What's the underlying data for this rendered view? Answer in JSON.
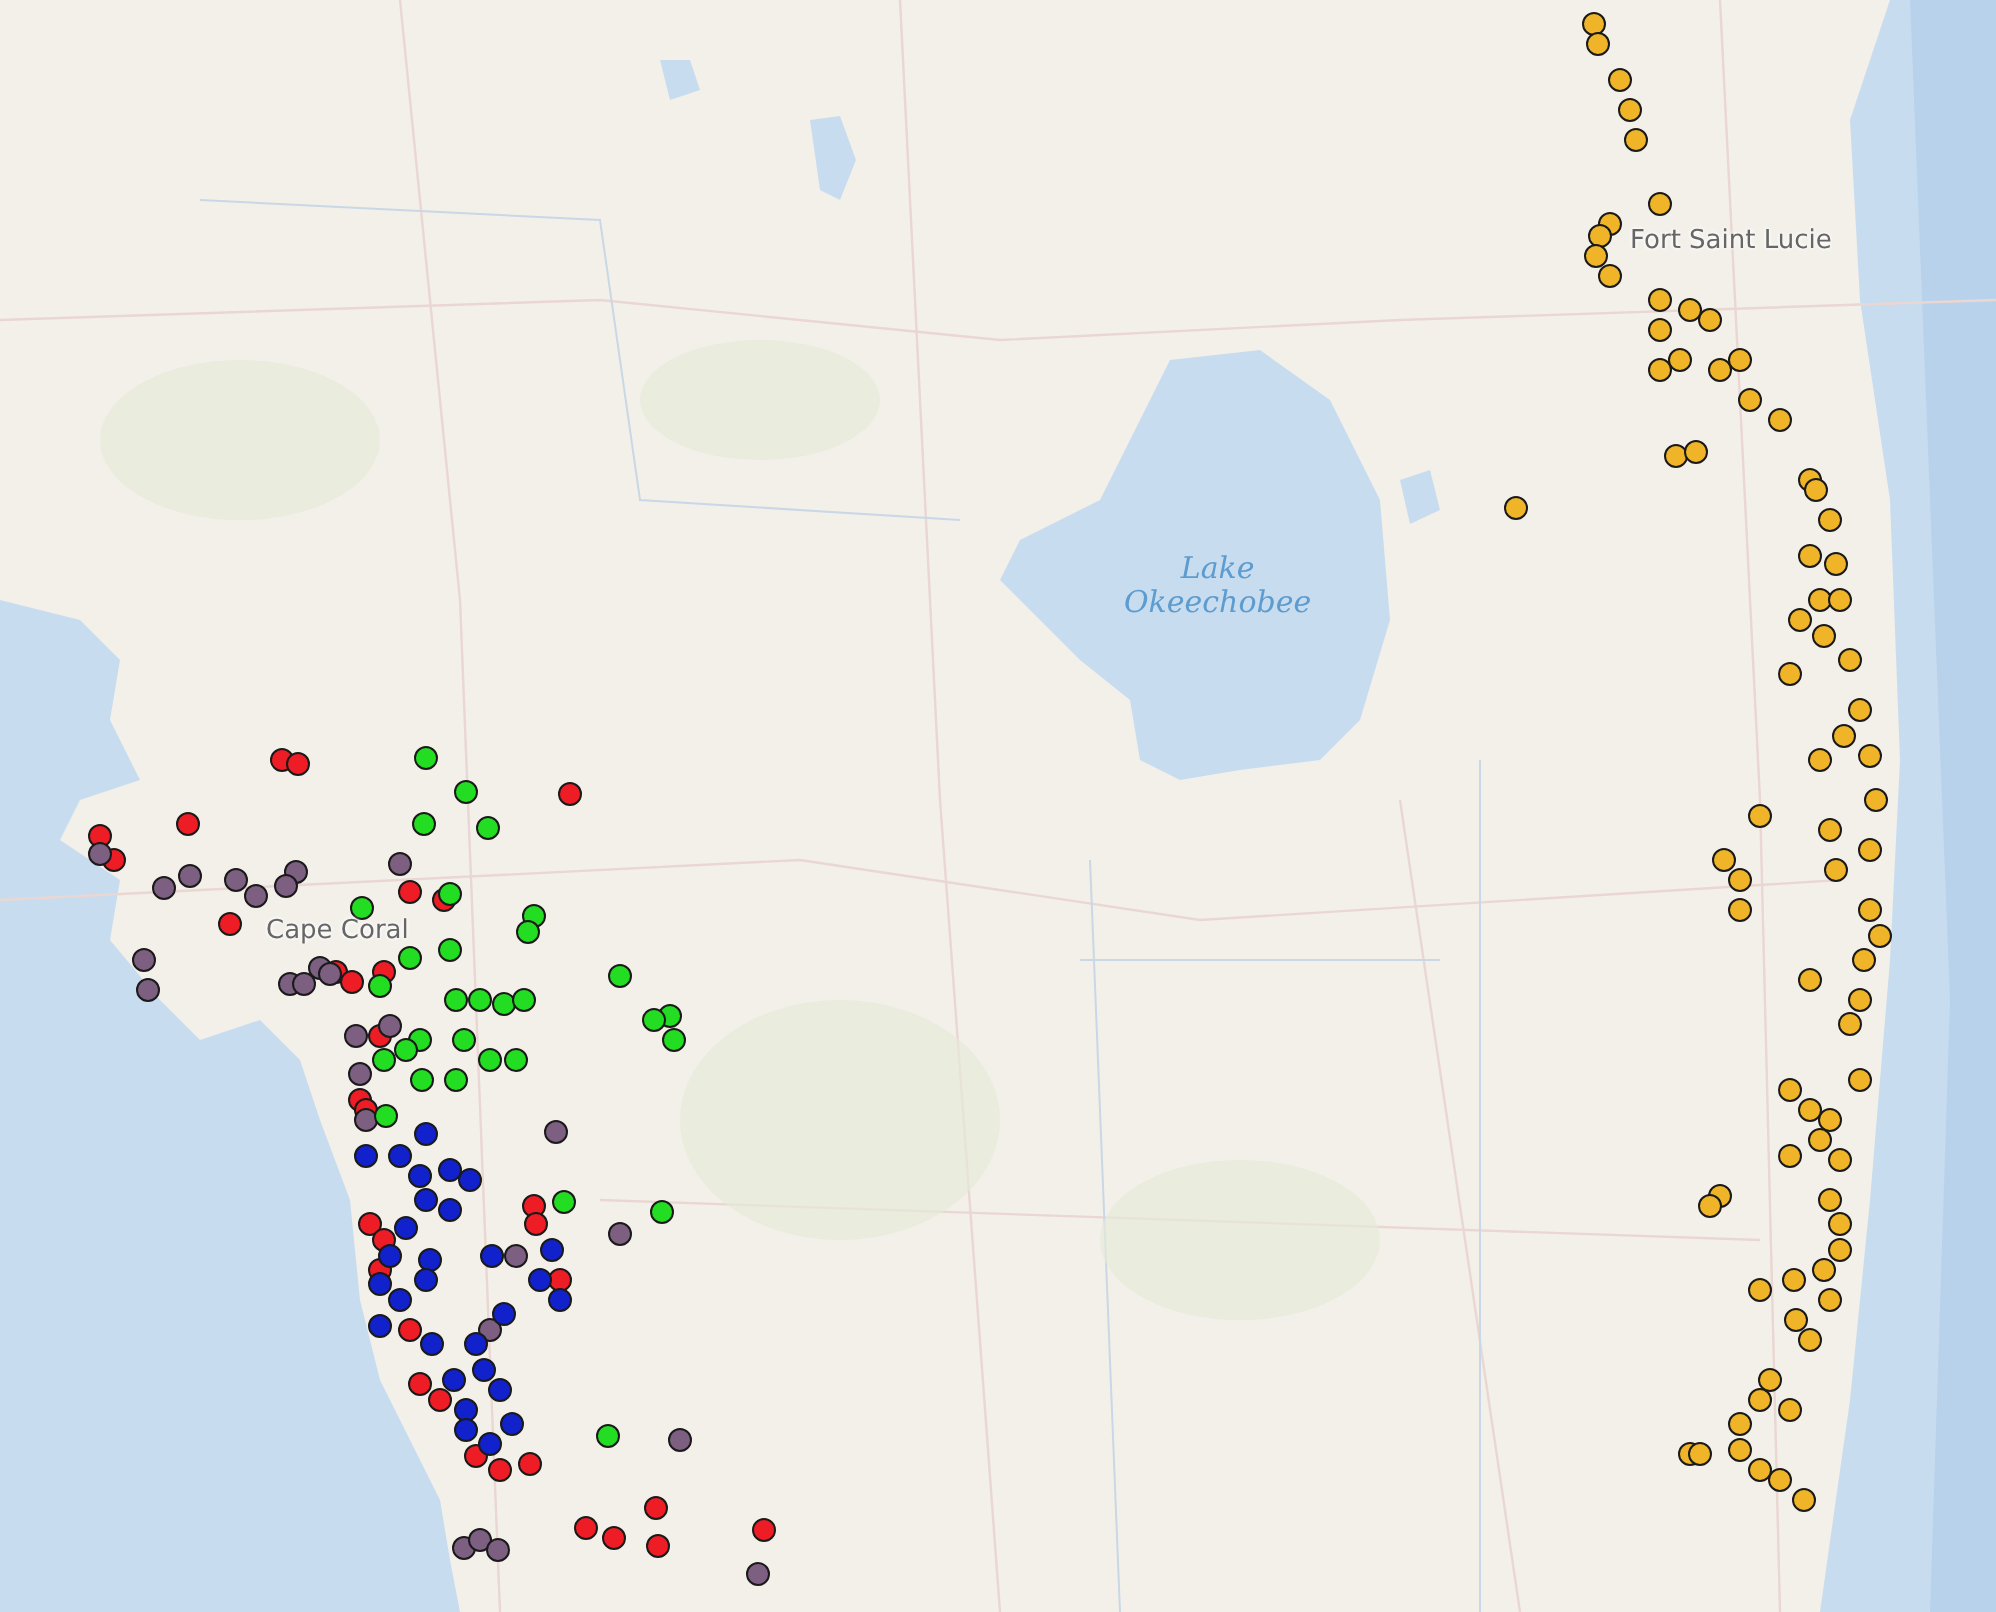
{
  "map": {
    "labels": [
      {
        "kind": "city",
        "text": "Fort Saint Lucie"
      },
      {
        "kind": "water",
        "text": "Lake",
        "text2": "Okeechobee"
      },
      {
        "kind": "city",
        "text": "Cape Coral"
      }
    ],
    "markers": [
      {
        "color": "#f0b429"
      },
      {
        "color": "#f0b429"
      },
      {
        "color": "#f0b429"
      },
      {
        "color": "#f0b429"
      },
      {
        "color": "#f0b429"
      },
      {
        "color": "#f0b429"
      },
      {
        "color": "#f0b429"
      },
      {
        "color": "#f0b429"
      },
      {
        "color": "#f0b429"
      },
      {
        "color": "#f0b429"
      },
      {
        "color": "#f0b429"
      },
      {
        "color": "#f0b429"
      },
      {
        "color": "#f0b429"
      },
      {
        "color": "#f0b429"
      },
      {
        "color": "#f0b429"
      },
      {
        "color": "#f0b429"
      },
      {
        "color": "#f0b429"
      },
      {
        "color": "#f0b429"
      },
      {
        "color": "#f0b429"
      },
      {
        "color": "#f0b429"
      },
      {
        "color": "#f0b429"
      },
      {
        "color": "#f0b429"
      },
      {
        "color": "#f0b429"
      },
      {
        "color": "#f0b429"
      },
      {
        "color": "#f0b429"
      },
      {
        "color": "#f0b429"
      },
      {
        "color": "#f0b429"
      },
      {
        "color": "#f0b429"
      },
      {
        "color": "#f0b429"
      },
      {
        "color": "#f0b429"
      },
      {
        "color": "#f0b429"
      },
      {
        "color": "#f0b429"
      },
      {
        "color": "#f0b429"
      },
      {
        "color": "#f0b429"
      },
      {
        "color": "#f0b429"
      },
      {
        "color": "#f0b429"
      },
      {
        "color": "#f0b429"
      },
      {
        "color": "#f0b429"
      },
      {
        "color": "#f0b429"
      },
      {
        "color": "#f0b429"
      },
      {
        "color": "#f0b429"
      },
      {
        "color": "#f0b429"
      },
      {
        "color": "#f0b429"
      },
      {
        "color": "#f0b429"
      },
      {
        "color": "#f0b429"
      },
      {
        "color": "#f0b429"
      },
      {
        "color": "#f0b429"
      },
      {
        "color": "#f0b429"
      },
      {
        "color": "#f0b429"
      },
      {
        "color": "#f0b429"
      },
      {
        "color": "#f0b429"
      },
      {
        "color": "#f0b429"
      },
      {
        "color": "#f0b429"
      },
      {
        "color": "#f0b429"
      },
      {
        "color": "#f0b429"
      },
      {
        "color": "#f0b429"
      },
      {
        "color": "#f0b429"
      },
      {
        "color": "#f0b429"
      },
      {
        "color": "#f0b429"
      },
      {
        "color": "#f0b429"
      },
      {
        "color": "#f0b429"
      },
      {
        "color": "#f0b429"
      },
      {
        "color": "#f0b429"
      },
      {
        "color": "#f0b429"
      },
      {
        "color": "#f0b429"
      },
      {
        "color": "#f0b429"
      },
      {
        "color": "#f0b429"
      },
      {
        "color": "#f0b429"
      },
      {
        "color": "#f0b429"
      },
      {
        "color": "#f0b429"
      },
      {
        "color": "#f0b429"
      },
      {
        "color": "#f0b429"
      },
      {
        "color": "#f0b429"
      },
      {
        "color": "#f0b429"
      },
      {
        "color": "#f0b429"
      },
      {
        "color": "#f0b429"
      },
      {
        "color": "#f0b429"
      },
      {
        "color": "#f0b429"
      },
      {
        "color": "#f0b429"
      },
      {
        "color": "#f0b429"
      },
      {
        "color": "#ee1c25"
      },
      {
        "color": "#ee1c25"
      },
      {
        "color": "#ee1c25"
      },
      {
        "color": "#ee1c25"
      },
      {
        "color": "#ee1c25"
      },
      {
        "color": "#ee1c25"
      },
      {
        "color": "#ee1c25"
      },
      {
        "color": "#ee1c25"
      },
      {
        "color": "#ee1c25"
      },
      {
        "color": "#ee1c25"
      },
      {
        "color": "#ee1c25"
      },
      {
        "color": "#ee1c25"
      },
      {
        "color": "#ee1c25"
      },
      {
        "color": "#ee1c25"
      },
      {
        "color": "#ee1c25"
      },
      {
        "color": "#ee1c25"
      },
      {
        "color": "#ee1c25"
      },
      {
        "color": "#ee1c25"
      },
      {
        "color": "#ee1c25"
      },
      {
        "color": "#ee1c25"
      },
      {
        "color": "#ee1c25"
      },
      {
        "color": "#ee1c25"
      },
      {
        "color": "#ee1c25"
      },
      {
        "color": "#ee1c25"
      },
      {
        "color": "#ee1c25"
      },
      {
        "color": "#ee1c25"
      },
      {
        "color": "#ee1c25"
      },
      {
        "color": "#ee1c25"
      },
      {
        "color": "#ee1c25"
      },
      {
        "color": "#ee1c25"
      },
      {
        "color": "#ee1c25"
      },
      {
        "color": "#ee1c25"
      },
      {
        "color": "#7d5f82"
      },
      {
        "color": "#7d5f82"
      },
      {
        "color": "#7d5f82"
      },
      {
        "color": "#7d5f82"
      },
      {
        "color": "#7d5f82"
      },
      {
        "color": "#7d5f82"
      },
      {
        "color": "#7d5f82"
      },
      {
        "color": "#7d5f82"
      },
      {
        "color": "#7d5f82"
      },
      {
        "color": "#7d5f82"
      },
      {
        "color": "#7d5f82"
      },
      {
        "color": "#7d5f82"
      },
      {
        "color": "#7d5f82"
      },
      {
        "color": "#7d5f82"
      },
      {
        "color": "#7d5f82"
      },
      {
        "color": "#7d5f82"
      },
      {
        "color": "#7d5f82"
      },
      {
        "color": "#7d5f82"
      },
      {
        "color": "#7d5f82"
      },
      {
        "color": "#7d5f82"
      },
      {
        "color": "#7d5f82"
      },
      {
        "color": "#7d5f82"
      },
      {
        "color": "#7d5f82"
      },
      {
        "color": "#7d5f82"
      },
      {
        "color": "#7d5f82"
      },
      {
        "color": "#7d5f82"
      },
      {
        "color": "#7d5f82"
      },
      {
        "color": "#22dd22"
      },
      {
        "color": "#22dd22"
      },
      {
        "color": "#22dd22"
      },
      {
        "color": "#22dd22"
      },
      {
        "color": "#22dd22"
      },
      {
        "color": "#22dd22"
      },
      {
        "color": "#22dd22"
      },
      {
        "color": "#22dd22"
      },
      {
        "color": "#22dd22"
      },
      {
        "color": "#22dd22"
      },
      {
        "color": "#22dd22"
      },
      {
        "color": "#22dd22"
      },
      {
        "color": "#22dd22"
      },
      {
        "color": "#22dd22"
      },
      {
        "color": "#22dd22"
      },
      {
        "color": "#22dd22"
      },
      {
        "color": "#22dd22"
      },
      {
        "color": "#22dd22"
      },
      {
        "color": "#22dd22"
      },
      {
        "color": "#22dd22"
      },
      {
        "color": "#22dd22"
      },
      {
        "color": "#22dd22"
      },
      {
        "color": "#22dd22"
      },
      {
        "color": "#22dd22"
      },
      {
        "color": "#22dd22"
      },
      {
        "color": "#22dd22"
      },
      {
        "color": "#22dd22"
      },
      {
        "color": "#22dd22"
      },
      {
        "color": "#22dd22"
      },
      {
        "color": "#22dd22"
      },
      {
        "color": "#22dd22"
      },
      {
        "color": "#1122cc"
      },
      {
        "color": "#1122cc"
      },
      {
        "color": "#1122cc"
      },
      {
        "color": "#1122cc"
      },
      {
        "color": "#1122cc"
      },
      {
        "color": "#1122cc"
      },
      {
        "color": "#1122cc"
      },
      {
        "color": "#1122cc"
      },
      {
        "color": "#1122cc"
      },
      {
        "color": "#1122cc"
      },
      {
        "color": "#1122cc"
      },
      {
        "color": "#1122cc"
      },
      {
        "color": "#1122cc"
      },
      {
        "color": "#1122cc"
      },
      {
        "color": "#1122cc"
      },
      {
        "color": "#1122cc"
      },
      {
        "color": "#1122cc"
      },
      {
        "color": "#1122cc"
      },
      {
        "color": "#1122cc"
      },
      {
        "color": "#1122cc"
      },
      {
        "color": "#1122cc"
      },
      {
        "color": "#1122cc"
      },
      {
        "color": "#1122cc"
      },
      {
        "color": "#1122cc"
      },
      {
        "color": "#1122cc"
      },
      {
        "color": "#1122cc"
      },
      {
        "color": "#1122cc"
      },
      {
        "color": "#1122cc"
      },
      {
        "color": "#1122cc"
      }
    ]
  }
}
